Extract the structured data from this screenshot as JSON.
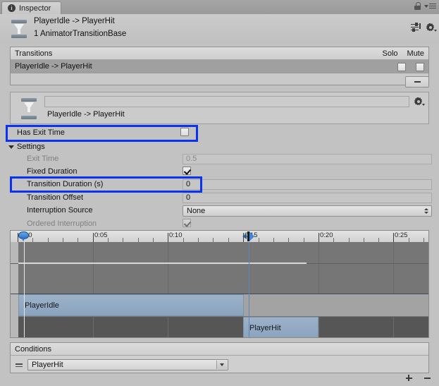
{
  "window": {
    "tab_label": "Inspector",
    "tab_icon": "info-icon",
    "lock_icon": "lock-icon",
    "menu_icon": "hamburger-menu-icon"
  },
  "object_header": {
    "icon": "animator-transition-icon",
    "title": "PlayerIdle -> PlayerHit",
    "subtitle": "1 AnimatorTransitionBase",
    "preset_icon": "preset-sliders-icon",
    "gear_icon": "gear-icon"
  },
  "transitions_panel": {
    "header_label": "Transitions",
    "solo_label": "Solo",
    "mute_label": "Mute",
    "rows": [
      {
        "label": "PlayerIdle -> PlayerHit",
        "solo": false,
        "mute": false
      }
    ],
    "remove_button": "−"
  },
  "preview": {
    "icon": "animator-transition-icon",
    "field_value": "",
    "name": "PlayerIdle -> PlayerHit",
    "gear_icon": "gear-icon"
  },
  "has_exit_time": {
    "label": "Has Exit Time",
    "checked": false,
    "highlighted": true
  },
  "settings": {
    "foldout_label": "Settings",
    "expanded": true,
    "fields": [
      {
        "name": "exit-time",
        "label": "Exit Time",
        "type": "number",
        "value": "0.5",
        "disabled": true,
        "highlighted": false
      },
      {
        "name": "fixed-duration",
        "label": "Fixed Duration",
        "type": "checkbox",
        "value": true,
        "disabled": false,
        "highlighted": false
      },
      {
        "name": "transition-duration",
        "label": "Transition Duration (s)",
        "type": "number",
        "value": "0",
        "disabled": false,
        "highlighted": true
      },
      {
        "name": "transition-offset",
        "label": "Transition Offset",
        "type": "number",
        "value": "0",
        "disabled": false,
        "highlighted": false
      },
      {
        "name": "interruption-source",
        "label": "Interruption Source",
        "type": "dropdown",
        "value": "None",
        "disabled": false,
        "highlighted": false
      },
      {
        "name": "ordered-interruption",
        "label": "Ordered Interruption",
        "type": "checkbox",
        "value": true,
        "disabled": true,
        "highlighted": false
      }
    ]
  },
  "timeline": {
    "tick_labels": [
      "0:00",
      "0:05",
      "0:10",
      "0:15",
      "0:20",
      "0:25"
    ],
    "tick_seconds": [
      0,
      5,
      10,
      15,
      20,
      25
    ],
    "clips": [
      {
        "name": "PlayerIdle",
        "start": "0:00",
        "end": "0:15"
      },
      {
        "name": "PlayerHit",
        "start": "0:15",
        "end": "0:20"
      }
    ],
    "markers": [
      {
        "name": "exit-time-marker",
        "position": "0:00"
      },
      {
        "name": "transition-start-marker",
        "position": "0:15"
      }
    ]
  },
  "conditions_panel": {
    "header_label": "Conditions",
    "rows": [
      {
        "parameter": "PlayerHit"
      }
    ],
    "add_button": "+",
    "remove_button": "−"
  },
  "colors": {
    "annotation": "#0a33ef",
    "clip": "#8aa3bd",
    "panel_bg": "#c2c2c2",
    "timeline_bg": "#767676"
  }
}
